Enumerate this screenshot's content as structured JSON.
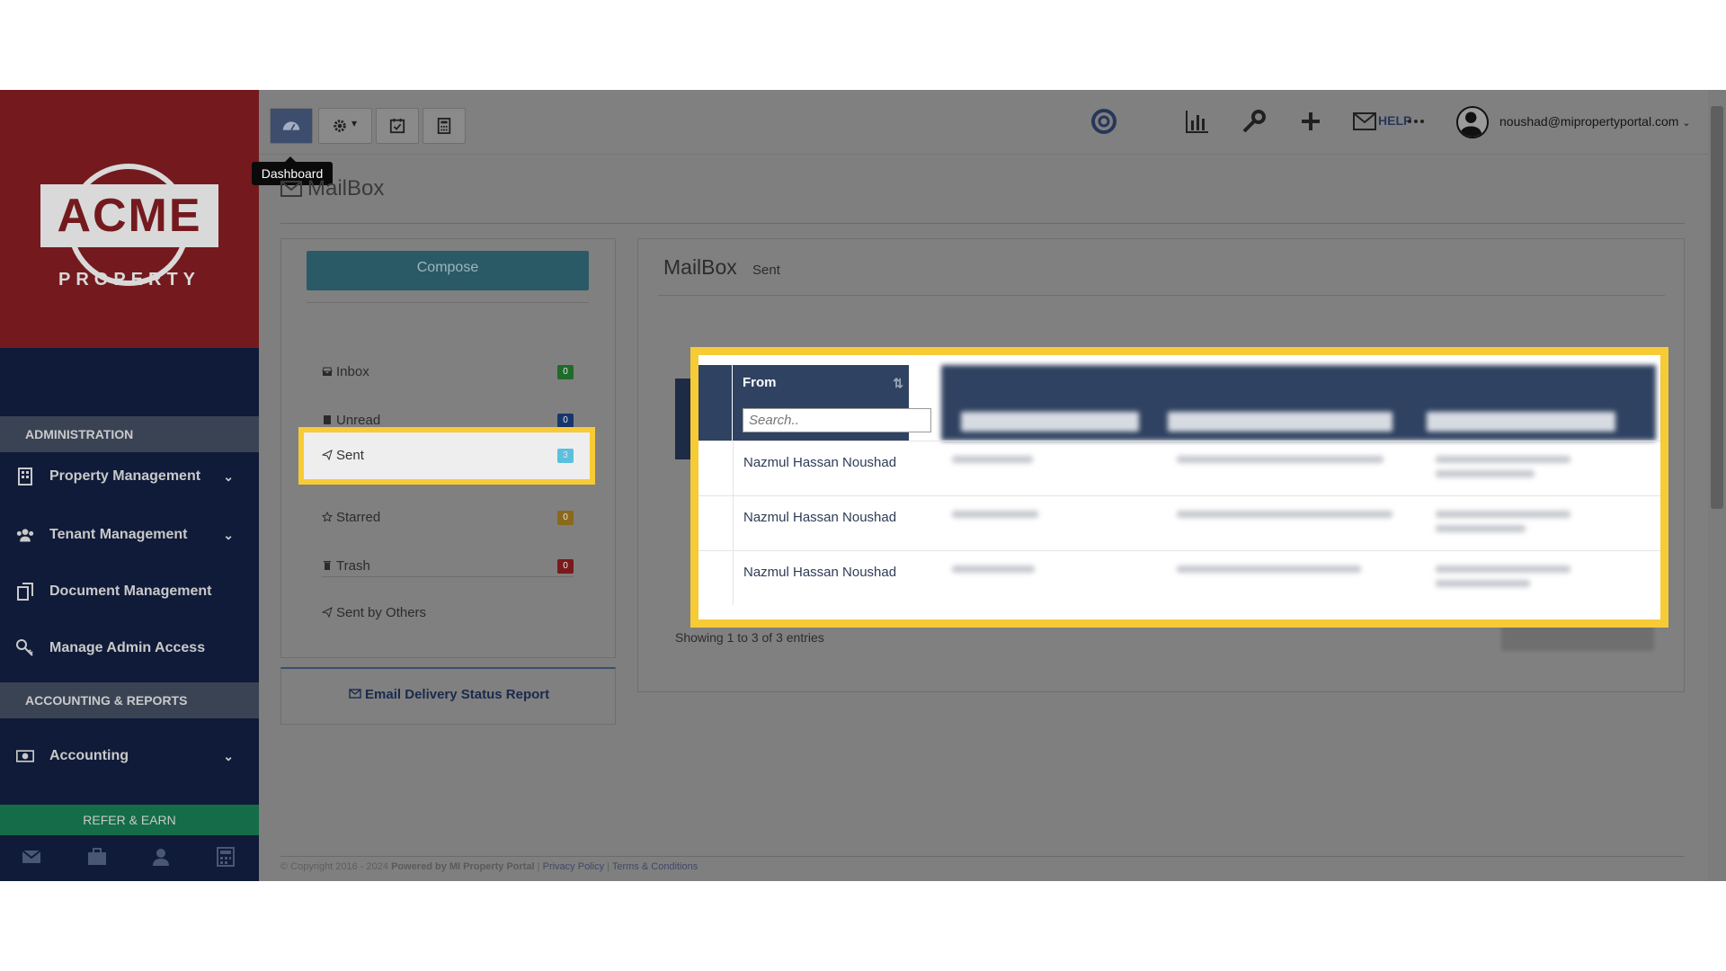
{
  "sidebar": {
    "logo_text": "ACME",
    "logo_sub": "PROPERTY",
    "sections": [
      {
        "label": "ADMINISTRATION"
      },
      {
        "label": "ACCOUNTING & REPORTS"
      }
    ],
    "items": [
      {
        "label": "Property Management",
        "icon": "building-icon"
      },
      {
        "label": "Tenant Management",
        "icon": "users-icon"
      },
      {
        "label": "Document Management",
        "icon": "documents-icon"
      },
      {
        "label": "Manage Admin Access",
        "icon": "key-icon"
      },
      {
        "label": "Accounting",
        "icon": "money-icon"
      }
    ],
    "refer_label": "REFER & EARN"
  },
  "topbar": {
    "tooltip": "Dashboard",
    "help_label": "HELP",
    "user_email": "noushad@mipropertyportal.com"
  },
  "page": {
    "title": "MailBox"
  },
  "left_panel": {
    "compose_label": "Compose",
    "folders": [
      {
        "label": "Inbox",
        "count": "0",
        "color": "#1f6b2a"
      },
      {
        "label": "Unread",
        "count": "0",
        "color": "#17366c"
      },
      {
        "label": "Sent",
        "count": "3",
        "color": "#5bc0de"
      },
      {
        "label": "Starred",
        "count": "0",
        "color": "#8a6a1a"
      },
      {
        "label": "Trash",
        "count": "0",
        "color": "#7a1a1a"
      },
      {
        "label": "Sent by Others"
      }
    ],
    "delivery_label": "Email Delivery Status Report"
  },
  "right_panel": {
    "title": "MailBox",
    "subtitle": "Sent",
    "table": {
      "column_from": "From",
      "search_placeholder": "Search..",
      "rows": [
        {
          "from": "Nazmul Hassan Noushad"
        },
        {
          "from": "Nazmul Hassan Noushad"
        },
        {
          "from": "Nazmul Hassan Noushad"
        }
      ]
    },
    "showing": "Showing 1 to 3 of 3 entries"
  },
  "footer": {
    "copyright": "© Copyright 2016 - 2024",
    "powered": "Powered by MI Property Portal",
    "privacy": "Privacy Policy",
    "terms": "Terms & Conditions"
  },
  "colors": {
    "highlight": "#f6cb36",
    "table_header": "#2f4261",
    "compose": "#2b5a67"
  }
}
